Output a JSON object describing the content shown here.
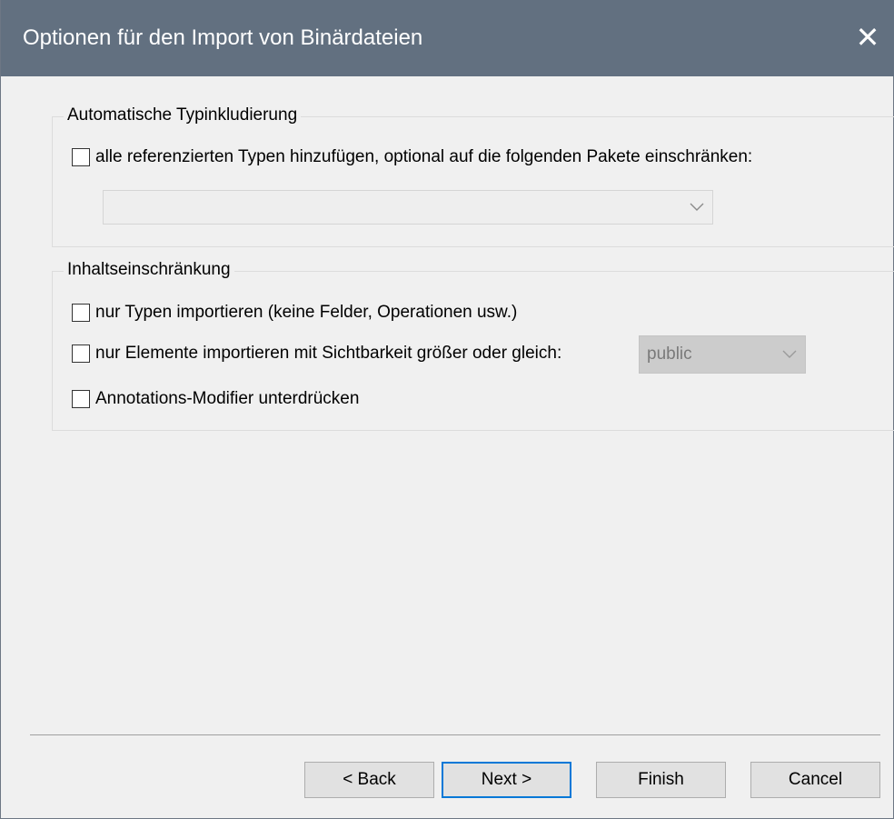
{
  "window": {
    "title": "Optionen für den Import von Binärdateien",
    "close_symbol": "✕"
  },
  "group_auto": {
    "legend": "Automatische Typinkludierung",
    "checkbox_label": "alle referenzierten Typen hinzufügen, optional auf die folgenden Pakete einschränken:",
    "checked": false,
    "packages_value": ""
  },
  "group_content": {
    "legend": "Inhaltseinschränkung",
    "types_only_label": "nur Typen importieren (keine Felder, Operationen usw.)",
    "visibility_label": "nur Elemente importieren mit Sichtbarkeit größer oder gleich:",
    "visibility_value": "public",
    "suppress_label": "Annotations-Modifier unterdrücken"
  },
  "buttons": {
    "back": "< Back",
    "next": "Next >",
    "finish": "Finish",
    "cancel": "Cancel"
  },
  "icons": {
    "close": "close-icon",
    "dropdown": "chevron-down-icon"
  }
}
